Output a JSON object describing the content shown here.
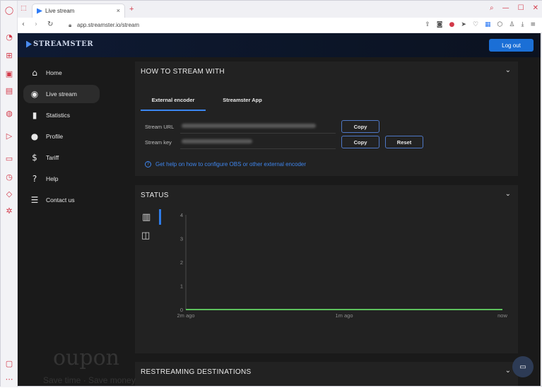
{
  "browser": {
    "tab_title": "Live stream",
    "url": "app.streamster.io/stream",
    "new_tab": "+",
    "tab_close": "×",
    "window_controls": [
      "⌕",
      "—",
      "☐",
      "✕"
    ],
    "rail_icons": [
      "opera-logo",
      "bag-icon",
      "twitch-icon",
      "notes-icon",
      "messenger-icon",
      "play-icon",
      "cast-icon",
      "history-icon",
      "cube-icon",
      "settings-icon"
    ],
    "accent": "#d33a4a"
  },
  "app": {
    "brand": "STREAMSTER",
    "logout_label": "Log out",
    "accent": "#1b6fd6"
  },
  "sidebar": {
    "items": [
      {
        "label": "Home",
        "icon": "⌂",
        "active": false
      },
      {
        "label": "Live stream",
        "icon": "◉",
        "active": true
      },
      {
        "label": "Statistics",
        "icon": "▮",
        "active": false
      },
      {
        "label": "Profile",
        "icon": "●",
        "active": false
      },
      {
        "label": "Tariff",
        "icon": "$",
        "active": false
      },
      {
        "label": "Help",
        "icon": "?",
        "active": false
      },
      {
        "label": "Contact us",
        "icon": "☰",
        "active": false
      }
    ]
  },
  "how_to_stream": {
    "title": "HOW TO STREAM WITH",
    "tabs": [
      "External encoder",
      "Streamster App"
    ],
    "active_tab": "External encoder",
    "stream_url_label": "Stream URL",
    "stream_key_label": "Stream key",
    "copy_label": "Copy",
    "reset_label": "Reset",
    "help_text": "Get help on how to configure OBS or other external encoder"
  },
  "status": {
    "title": "STATUS"
  },
  "chart_data": {
    "type": "line",
    "x": [
      "2m ago",
      "1m ago",
      "now"
    ],
    "y_ticks": [
      0,
      1,
      2,
      3,
      4
    ],
    "ylim": [
      0,
      4
    ],
    "series": [
      {
        "values": [
          0,
          0,
          0
        ],
        "color": "#5cc15c"
      }
    ]
  },
  "restream": {
    "title": "RESTREAMING DESTINATIONS"
  },
  "watermark": {
    "line1": "oupon",
    "line2": "Save time · Save money"
  }
}
